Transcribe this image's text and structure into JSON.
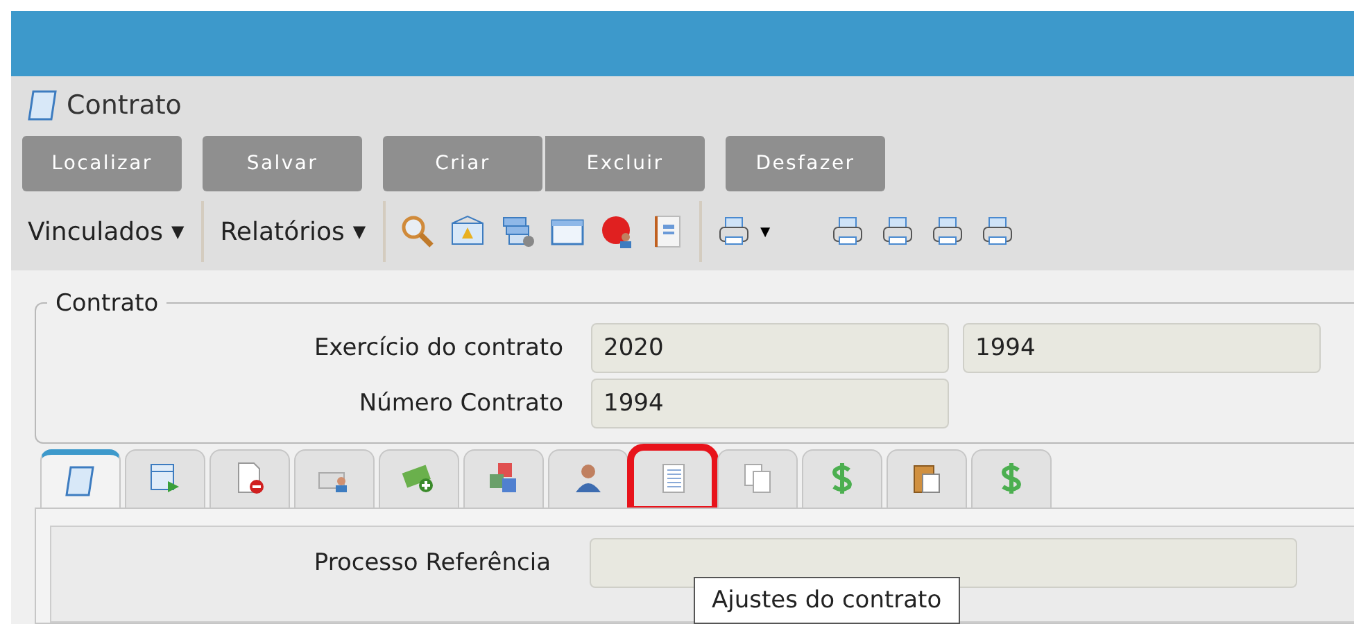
{
  "window": {
    "title": "Contrato"
  },
  "buttons": [
    {
      "label": "Localizar",
      "joined": false
    },
    {
      "label": "Salvar",
      "joined": false
    },
    {
      "label": "Criar",
      "joined": false
    },
    {
      "label": "Excluir",
      "joined": true
    },
    {
      "label": "Desfazer",
      "joined": false
    }
  ],
  "menus": [
    {
      "label": "Vinculados",
      "caret": "▼"
    },
    {
      "label": "Relatórios",
      "caret": "▼"
    }
  ],
  "toolbar_icons": [
    {
      "kind": "search"
    },
    {
      "kind": "mail"
    },
    {
      "kind": "windows"
    },
    {
      "kind": "window"
    },
    {
      "kind": "record-user"
    },
    {
      "kind": "notebook"
    },
    {
      "kind": "sep"
    },
    {
      "kind": "printer-menu",
      "caret": "▼"
    },
    {
      "kind": "gap"
    },
    {
      "kind": "printer"
    },
    {
      "kind": "printer"
    },
    {
      "kind": "printer"
    },
    {
      "kind": "printer"
    }
  ],
  "fieldset": {
    "legend": "Contrato",
    "rows": [
      {
        "label": "Exercício do contrato",
        "values": [
          "2020",
          "1994"
        ]
      },
      {
        "label": "Número Contrato",
        "values": [
          "1994"
        ]
      }
    ]
  },
  "tabs": [
    {
      "kind": "scroll",
      "selected": true,
      "highlighted": false
    },
    {
      "kind": "sheet-arrow",
      "selected": false,
      "highlighted": false
    },
    {
      "kind": "doc-minus",
      "selected": false,
      "highlighted": false
    },
    {
      "kind": "card-user",
      "selected": false,
      "highlighted": false
    },
    {
      "kind": "money-plus",
      "selected": false,
      "highlighted": false
    },
    {
      "kind": "cubes",
      "selected": false,
      "highlighted": false
    },
    {
      "kind": "user",
      "selected": false,
      "highlighted": false
    },
    {
      "kind": "list",
      "selected": false,
      "highlighted": true
    },
    {
      "kind": "copies",
      "selected": false,
      "highlighted": false
    },
    {
      "kind": "dollar",
      "selected": false,
      "highlighted": false
    },
    {
      "kind": "clipboard",
      "selected": false,
      "highlighted": false
    },
    {
      "kind": "dollar",
      "selected": false,
      "highlighted": false
    }
  ],
  "tooltip": "Ajustes do contrato",
  "panel": {
    "fields": [
      {
        "label": "Processo Referência"
      }
    ]
  }
}
